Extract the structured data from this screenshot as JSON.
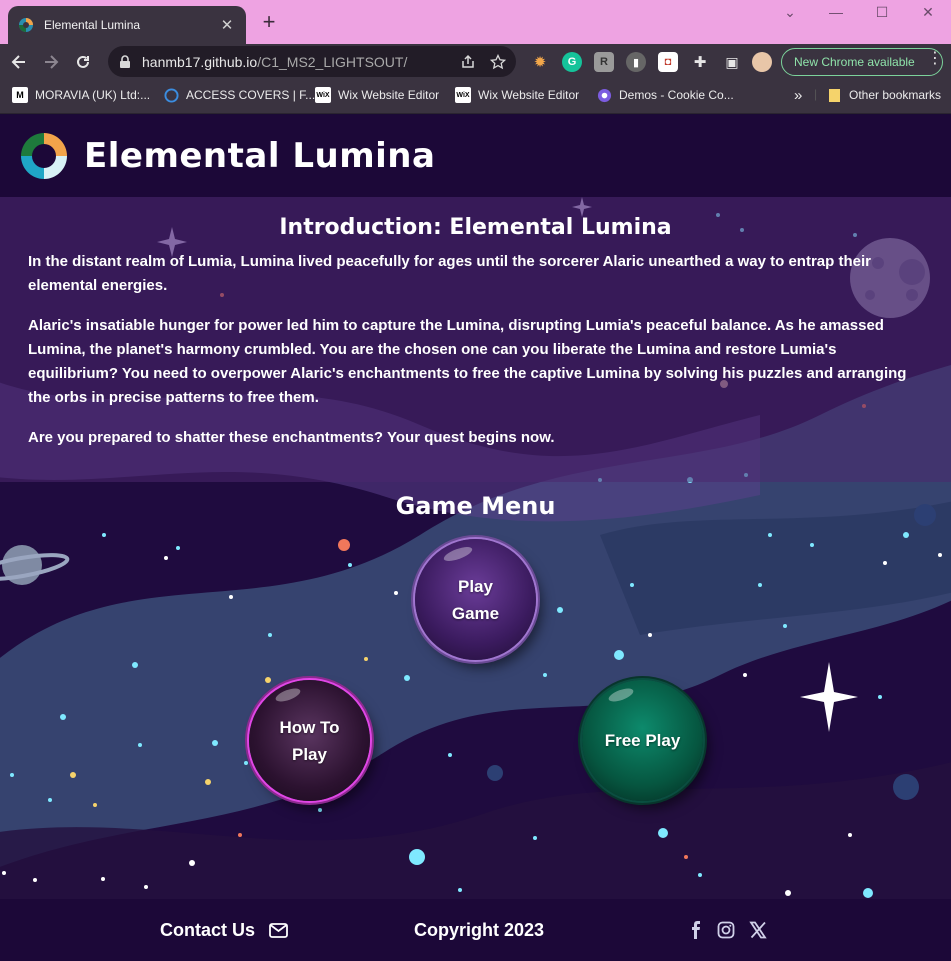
{
  "browser": {
    "tab_title": "Elemental Lumina",
    "url_domain": "hanmb17.github.io",
    "url_path": "/C1_MS2_LIGHTSOUT/",
    "update_label": "New Chrome available",
    "bookmarks": [
      {
        "label": "MORAVIA (UK) Ltd:...",
        "icon": "M"
      },
      {
        "label": "ACCESS COVERS | F...",
        "icon": "circle"
      },
      {
        "label": "Wix Website Editor",
        "icon": "WiX"
      },
      {
        "label": "Wix Website Editor",
        "icon": "WiX"
      },
      {
        "label": "Demos - Cookie Co...",
        "icon": "dot"
      }
    ],
    "overflow_label": "»",
    "other_bookmarks_label": "Other bookmarks"
  },
  "site": {
    "title": "Elemental Lumina"
  },
  "intro": {
    "title": "Introduction: Elemental Lumina",
    "paragraphs": [
      "In the distant realm of Lumia, Lumina lived peacefully for ages until the sorcerer Alaric unearthed a way to entrap their elemental energies.",
      "Alaric's insatiable hunger for power led him to capture the Lumina, disrupting Lumia's peaceful balance. As he amassed Lumina, the planet's harmony crumbled. You are the chosen one can you liberate the Lumina and restore Lumia's equilibrium? You need to overpower Alaric's enchantments to free the captive Lumina by solving his puzzles and arranging the orbs in precise patterns to free them.",
      "Are you prepared to shatter these enchantments? Your quest begins now."
    ]
  },
  "menu": {
    "title": "Game Menu",
    "play_label": "Play\nGame",
    "how_label": "How To\nPlay",
    "free_label": "Free Play"
  },
  "footer": {
    "contact_label": "Contact Us",
    "copyright": "Copyright 2023",
    "icons": [
      "facebook-icon",
      "instagram-icon",
      "x-icon"
    ]
  }
}
